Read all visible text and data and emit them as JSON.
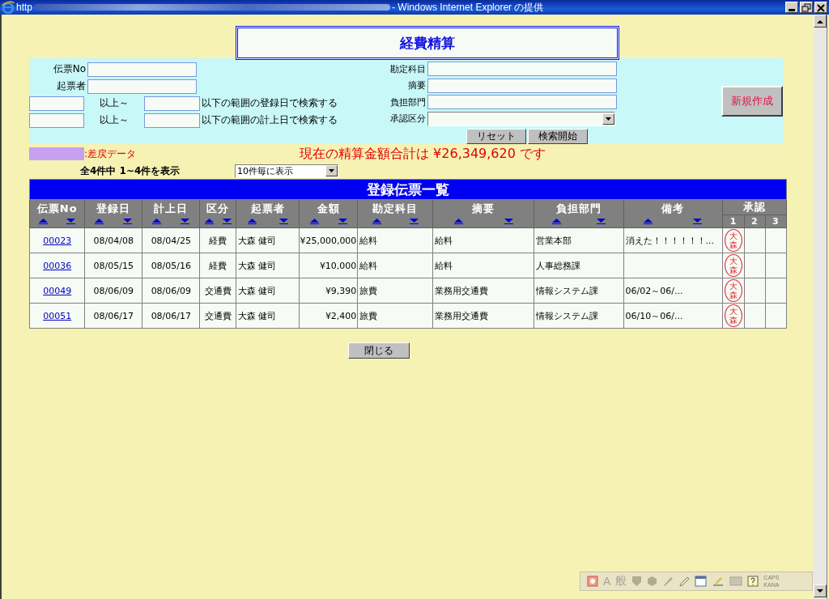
{
  "window": {
    "title_start": "http",
    "title_end": "- Windows Internet Explorer の提供"
  },
  "page_title": "経費精算",
  "search": {
    "left_fields": [
      {
        "label": "伝票No"
      },
      {
        "label": "起票者"
      }
    ],
    "date_ranges": [
      {
        "middle": "以上～",
        "suffix": "以下の範囲の登録日で検索する"
      },
      {
        "middle": "以上～",
        "suffix": "以下の範囲の計上日で検索する"
      }
    ],
    "right_fields": [
      {
        "label": "勘定科目",
        "kind": "text"
      },
      {
        "label": "摘要",
        "kind": "text"
      },
      {
        "label": "負担部門",
        "kind": "text"
      },
      {
        "label": "承認区分",
        "kind": "select"
      }
    ],
    "buttons": [
      "リセット",
      "検索開始"
    ],
    "new_button": "新規作成"
  },
  "legend": {
    "color": "#c8a0f0",
    "label": ":差戻データ"
  },
  "total": "現在の精算金額合計は ¥26,349,620 です",
  "count": "全4件中 1~4件を表示",
  "page_size": "10件毎に表示",
  "table": {
    "title": "登録伝票一覧",
    "columns": [
      "伝票No",
      "登録日",
      "計上日",
      "区分",
      "起票者",
      "金額",
      "勘定科目",
      "摘要",
      "負担部門",
      "備考"
    ],
    "approval": {
      "label": "承認",
      "slots": [
        "1",
        "2",
        "3"
      ]
    },
    "rows": [
      {
        "cells": [
          "00023",
          "08/04/08",
          "08/04/25",
          "経費",
          "大森 健司",
          "¥25,000,000",
          "給料",
          "給料",
          "営業本部",
          "消えた！！！！！！..."
        ],
        "stamp": "大森"
      },
      {
        "cells": [
          "00036",
          "08/05/15",
          "08/05/16",
          "経費",
          "大森 健司",
          "¥10,000",
          "給料",
          "給料",
          "人事総務課",
          ""
        ],
        "stamp": "大森"
      },
      {
        "cells": [
          "00049",
          "08/06/09",
          "08/06/09",
          "交通費",
          "大森 健司",
          "¥9,390",
          "旅費",
          "業務用交通費",
          "情報システム課",
          "06/02～06/..."
        ],
        "stamp": "大森"
      },
      {
        "cells": [
          "00051",
          "08/06/17",
          "08/06/17",
          "交通費",
          "大森 健司",
          "¥2,400",
          "旅費",
          "業務用交通費",
          "情報システム課",
          "06/10～06/..."
        ],
        "stamp": "大森"
      }
    ]
  },
  "close_button": "閉じる",
  "ime_bar": {
    "texts": [
      "A",
      "般",
      "CAPS",
      "KANA"
    ]
  }
}
